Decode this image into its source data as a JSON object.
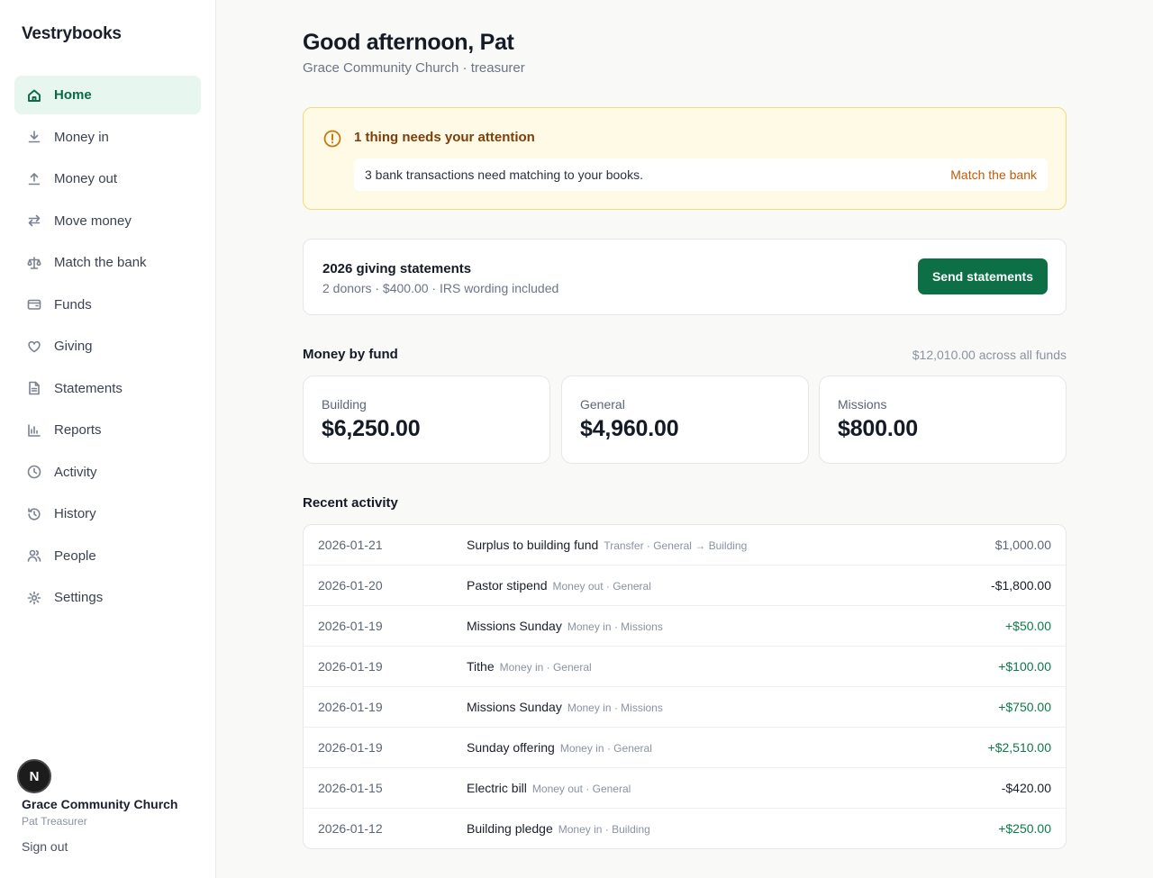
{
  "brand": "Vestrybooks",
  "nav": [
    {
      "label": "Home",
      "icon": "home-icon",
      "active": true
    },
    {
      "label": "Money in",
      "icon": "download-icon"
    },
    {
      "label": "Money out",
      "icon": "upload-icon"
    },
    {
      "label": "Move money",
      "icon": "transfer-icon"
    },
    {
      "label": "Match the bank",
      "icon": "scale-icon"
    },
    {
      "label": "Funds",
      "icon": "wallet-icon"
    },
    {
      "label": "Giving",
      "icon": "heart-icon"
    },
    {
      "label": "Statements",
      "icon": "document-icon"
    },
    {
      "label": "Reports",
      "icon": "bar-chart-icon"
    },
    {
      "label": "Activity",
      "icon": "clock-icon"
    },
    {
      "label": "History",
      "icon": "history-icon"
    },
    {
      "label": "People",
      "icon": "people-icon"
    },
    {
      "label": "Settings",
      "icon": "gear-icon"
    }
  ],
  "account": {
    "avatar_letter": "N",
    "org_name": "Grace Community Church",
    "user_name": "Pat Treasurer",
    "signout_label": "Sign out"
  },
  "header": {
    "greeting": "Good afternoon, Pat",
    "subtitle": "Grace Community Church · treasurer"
  },
  "alert": {
    "title": "1 thing needs your attention",
    "message": "3 bank transactions need matching to your books.",
    "action_label": "Match the bank"
  },
  "statements": {
    "title": "2026 giving statements",
    "subtitle": "2 donors · $400.00 · IRS wording included",
    "button_label": "Send statements"
  },
  "funds": {
    "title": "Money by fund",
    "total": "$12,010.00 across all funds",
    "items": [
      {
        "label": "Building",
        "value": "$6,250.00"
      },
      {
        "label": "General",
        "value": "$4,960.00"
      },
      {
        "label": "Missions",
        "value": "$800.00"
      }
    ]
  },
  "activity": {
    "title": "Recent activity",
    "rows": [
      {
        "date": "2026-01-21",
        "desc": "Surplus to building fund",
        "meta": "Transfer · General → Building",
        "amount": "$1,000.00",
        "kind": "neutral"
      },
      {
        "date": "2026-01-20",
        "desc": "Pastor stipend",
        "meta": "Money out · General",
        "amount": "-$1,800.00",
        "kind": "neg"
      },
      {
        "date": "2026-01-19",
        "desc": "Missions Sunday",
        "meta": "Money in · Missions",
        "amount": "+$50.00",
        "kind": "pos"
      },
      {
        "date": "2026-01-19",
        "desc": "Tithe",
        "meta": "Money in · General",
        "amount": "+$100.00",
        "kind": "pos"
      },
      {
        "date": "2026-01-19",
        "desc": "Missions Sunday",
        "meta": "Money in · Missions",
        "amount": "+$750.00",
        "kind": "pos"
      },
      {
        "date": "2026-01-19",
        "desc": "Sunday offering",
        "meta": "Money in · General",
        "amount": "+$2,510.00",
        "kind": "pos"
      },
      {
        "date": "2026-01-15",
        "desc": "Electric bill",
        "meta": "Money out · General",
        "amount": "-$420.00",
        "kind": "neg"
      },
      {
        "date": "2026-01-12",
        "desc": "Building pledge",
        "meta": "Money in · Building",
        "amount": "+$250.00",
        "kind": "pos"
      }
    ]
  },
  "colors": {
    "accent": "#0c6f46",
    "positive": "#0c7a4a",
    "alert_bg": "#fefae5",
    "alert_text": "#7c3e0a",
    "alert_link": "#c25a07"
  }
}
